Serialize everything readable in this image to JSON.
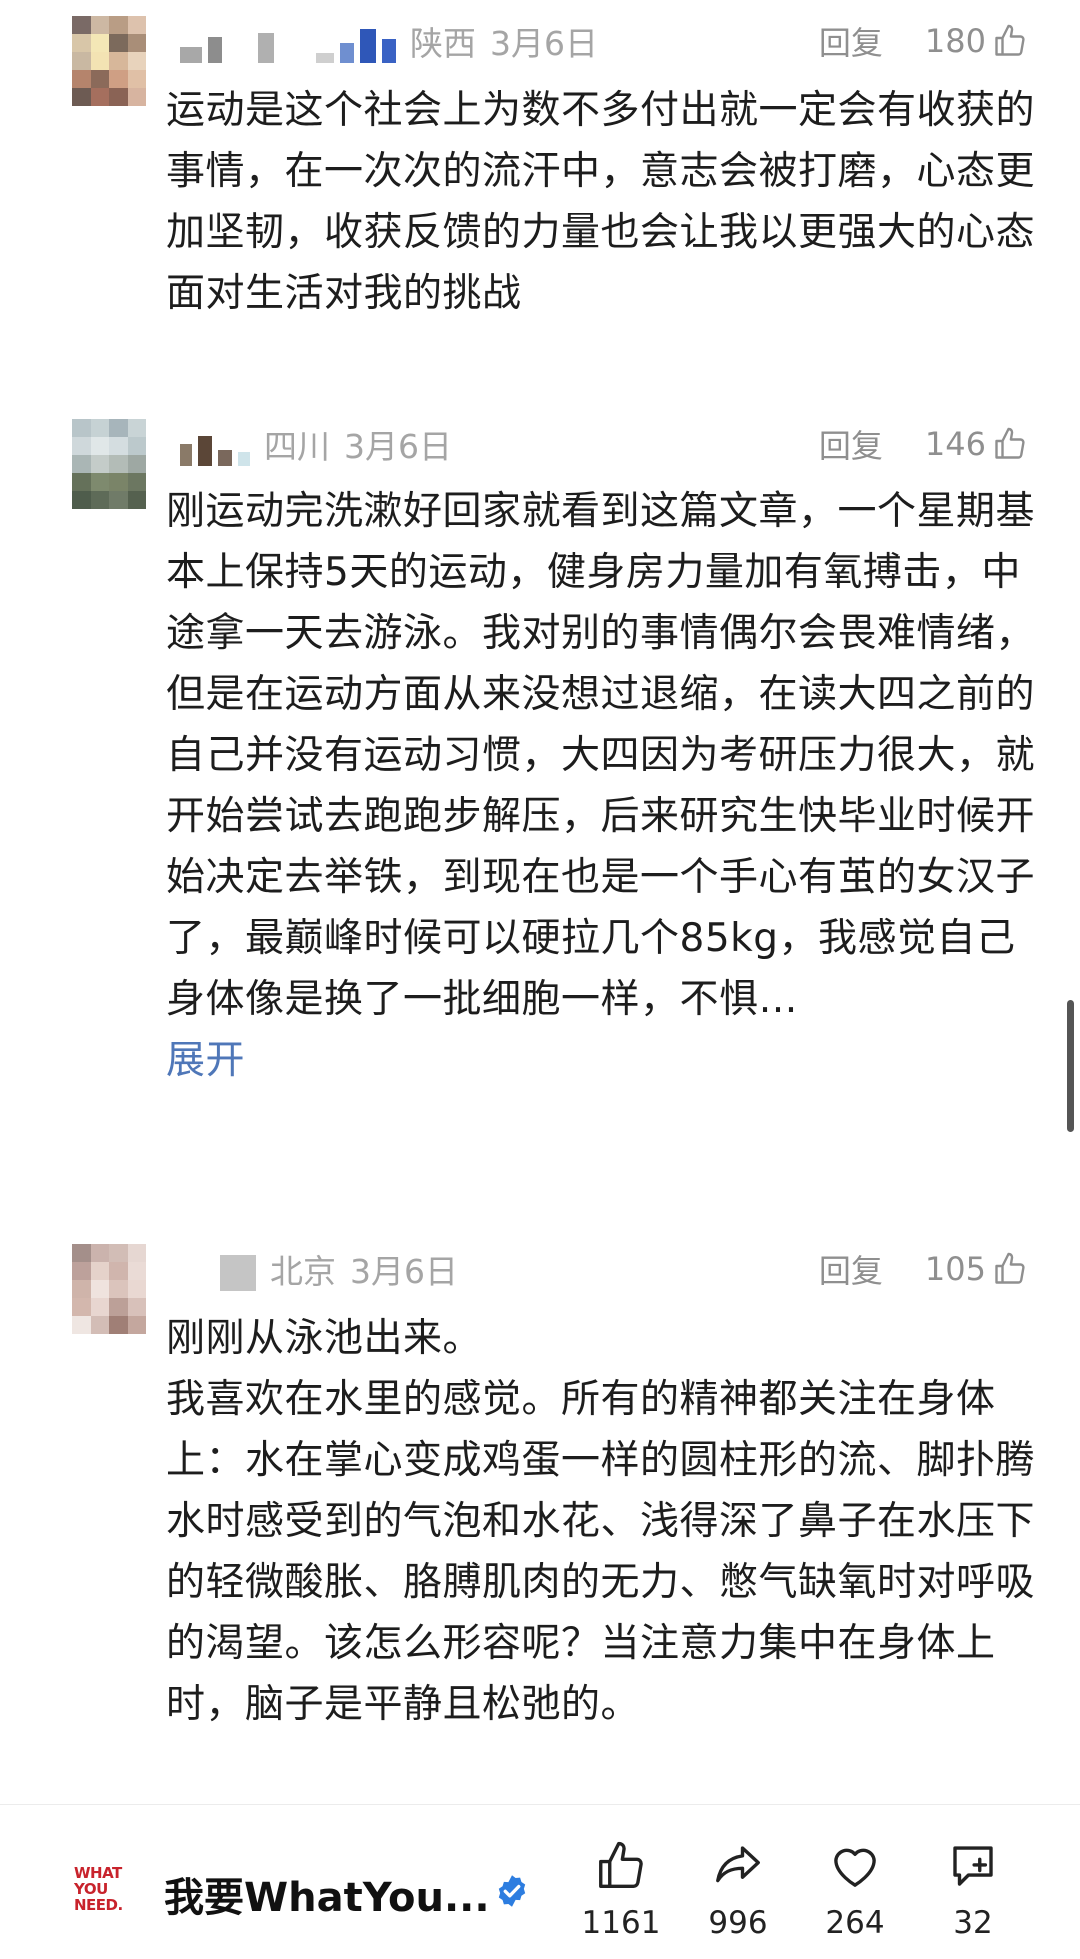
{
  "comments": [
    {
      "region": "陕西",
      "date": "3月6日",
      "reply_label": "回复",
      "likes": "180",
      "paragraphs": [
        "运动是这个社会上为数不多付出就一定会有收获的事情，在一次次的流汗中，意志会被打磨，心态更加坚韧，收获反馈的力量也会让我以更强大的心态面对生活对我的挑战"
      ]
    },
    {
      "region": "四川",
      "date": "3月6日",
      "reply_label": "回复",
      "likes": "146",
      "paragraphs": [
        "刚运动完洗漱好回家就看到这篇文章，一个星期基本上保持5天的运动，健身房力量加有氧搏击，中途拿一天去游泳。我对别的事情偶尔会畏难情绪，但是在运动方面从来没想过退缩，在读大四之前的自己并没有运动习惯，大四因为考研压力很大，就开始尝试去跑跑步解压，后来研究生快毕业时候开始决定去举铁，到现在也是一个手心有茧的女汉子了，最巅峰时候可以硬拉几个85kg，我感觉自己身体像是换了一批细胞一样，不惧…"
      ],
      "expand_label": "展开"
    },
    {
      "region": "北京",
      "date": "3月6日",
      "reply_label": "回复",
      "likes": "105",
      "paragraphs": [
        "刚刚从泳池出来。",
        "我喜欢在水里的感觉。所有的精神都关注在身体上：水在掌心变成鸡蛋一样的圆柱形的流、脚扑腾水时感受到的气泡和水花、浅得深了鼻子在水压下的轻微酸胀、胳膊肌肉的无力、憋气缺氧时对呼吸的渴望。该怎么形容呢？当注意力集中在身体上时，脑子是平静且松弛的。"
      ]
    }
  ],
  "bottom_bar": {
    "logo_text": "WHAT YOU NEED.",
    "account_name": "我要WhatYou...",
    "like_count": "1161",
    "share_count": "996",
    "favorite_count": "264",
    "comment_count": "32"
  },
  "colors": {
    "link": "#4f77b8",
    "verified": "#2d7de0",
    "logo": "#c8232c",
    "meta_gray": "#a5a5a5"
  },
  "icons": [
    "thumb-up-icon",
    "share-icon",
    "heart-icon",
    "comment-add-icon",
    "verified-badge-icon"
  ]
}
